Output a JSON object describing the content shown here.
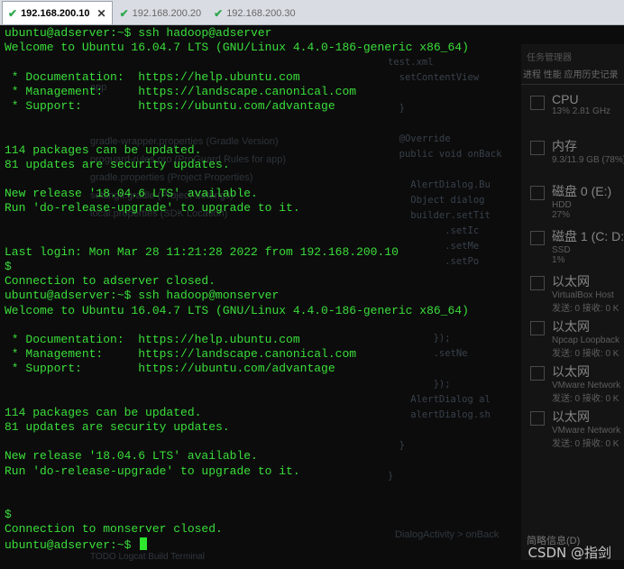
{
  "tabs": [
    {
      "label": "192.168.200.10",
      "active": true
    },
    {
      "label": "192.168.200.20",
      "active": false
    },
    {
      "label": "192.168.200.30",
      "active": false
    }
  ],
  "terminal": {
    "lines": [
      "ubuntu@adserver:~$ ssh hadoop@adserver",
      "Welcome to Ubuntu 16.04.7 LTS (GNU/Linux 4.4.0-186-generic x86_64)",
      "",
      " * Documentation:  https://help.ubuntu.com",
      " * Management:     https://landscape.canonical.com",
      " * Support:        https://ubuntu.com/advantage",
      "",
      "",
      "114 packages can be updated.",
      "81 updates are security updates.",
      "",
      "New release '18.04.6 LTS' available.",
      "Run 'do-release-upgrade' to upgrade to it.",
      "",
      "",
      "Last login: Mon Mar 28 11:21:28 2022 from 192.168.200.10",
      "$",
      "Connection to adserver closed.",
      "ubuntu@adserver:~$ ssh hadoop@monserver",
      "Welcome to Ubuntu 16.04.7 LTS (GNU/Linux 4.4.0-186-generic x86_64)",
      "",
      " * Documentation:  https://help.ubuntu.com",
      " * Management:     https://landscape.canonical.com",
      " * Support:        https://ubuntu.com/advantage",
      "",
      "",
      "114 packages can be updated.",
      "81 updates are security updates.",
      "",
      "New release '18.04.6 LTS' available.",
      "Run 'do-release-upgrade' to upgrade to it.",
      "",
      "",
      "$",
      "Connection to monserver closed."
    ],
    "prompt": "ubuntu@adserver:~$ "
  },
  "background": {
    "files": [
      "app",
      "",
      "",
      "gradle-wrapper.properties (Gradle Version)",
      "proguard-rules.pro (ProGuard Rules for app)",
      "gradle.properties (Project Properties)",
      "settings.gradle (Project Settings)",
      "local.properties (SDK Location)"
    ],
    "code": [
      "test.xml",
      "  setContentView",
      "",
      "  }",
      "",
      "  @Override",
      "  public void onBack",
      "",
      "    AlertDialog.Bu",
      "    Object dialog",
      "    builder.setTit",
      "          .setIc",
      "          .setMe",
      "          .setPo",
      "",
      "",
      "",
      "",
      "        });",
      "        .setNe",
      "",
      "        });",
      "    AlertDialog al",
      "    alertDialog.sh",
      "",
      "  }",
      "",
      "}"
    ],
    "ide_bottom": "TODO    Logcat    Build    Terminal",
    "ide_status": "DialogActivity  >  onBack",
    "task_manager": {
      "header": "任务管理器",
      "tabs": "进程  性能  应用历史记录",
      "items": [
        {
          "title": "CPU",
          "sub1": "13% 2.81 GHz",
          "sub2": ""
        },
        {
          "title": "内存",
          "sub1": "9.3/11.9 GB (78%)",
          "sub2": ""
        },
        {
          "title": "磁盘 0 (E:)",
          "sub1": "HDD",
          "sub2": "27%"
        },
        {
          "title": "磁盘 1 (C: D:)",
          "sub1": "SSD",
          "sub2": "1%"
        },
        {
          "title": "以太网",
          "sub1": "VirtualBox Host",
          "sub2": "发送: 0 接收: 0 K"
        },
        {
          "title": "以太网",
          "sub1": "Npcap Loopback",
          "sub2": "发送: 0 接收: 0 K"
        },
        {
          "title": "以太网",
          "sub1": "VMware Network",
          "sub2": "发送: 0 接收: 0 K"
        },
        {
          "title": "以太网",
          "sub1": "VMware Network",
          "sub2": "发送: 0 接收: 0 K"
        }
      ],
      "footer": "简略信息(D)"
    }
  },
  "watermark": "CSDN @指剑",
  "colors": {
    "terminal_text": "#3adf3a",
    "terminal_bg": "#0c0c0c",
    "cursor": "#2ee62e"
  }
}
